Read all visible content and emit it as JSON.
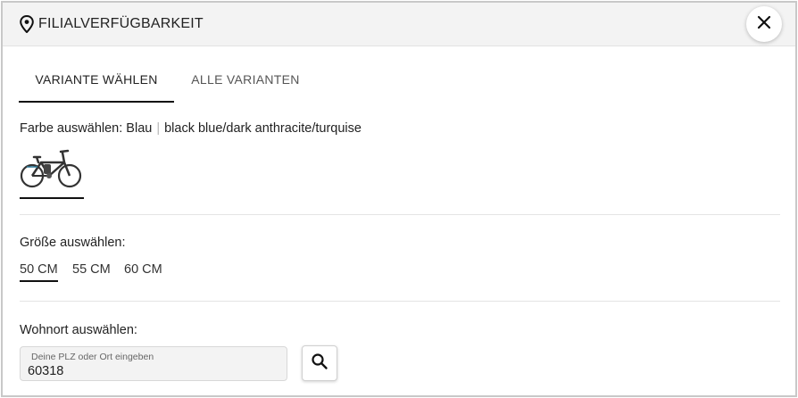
{
  "header": {
    "title": "FILIALVERFÜGBARKEIT",
    "icon": "location-pin-icon",
    "close_icon": "close-icon"
  },
  "tabs": [
    {
      "label": "VARIANTE WÄHLEN",
      "active": true
    },
    {
      "label": "ALLE VARIANTEN",
      "active": false
    }
  ],
  "color_section": {
    "label": "Farbe auswählen:",
    "selected_color": "Blau",
    "separator": "|",
    "color_detail": "black blue/dark anthracite/turquise",
    "swatch_icon": "bicycle-icon"
  },
  "size_section": {
    "label": "Größe auswählen:",
    "options": [
      {
        "label": "50 CM",
        "selected": true
      },
      {
        "label": "55 CM",
        "selected": false
      },
      {
        "label": "60 CM",
        "selected": false
      }
    ]
  },
  "location_section": {
    "label": "Wohnort auswählen:",
    "input_placeholder": "Deine PLZ oder Ort eingeben",
    "input_value": "60318",
    "search_icon": "search-icon"
  },
  "colors": {
    "header_bg": "#f3f3f3",
    "accent": "#111111",
    "divider": "#e4e4e4"
  }
}
